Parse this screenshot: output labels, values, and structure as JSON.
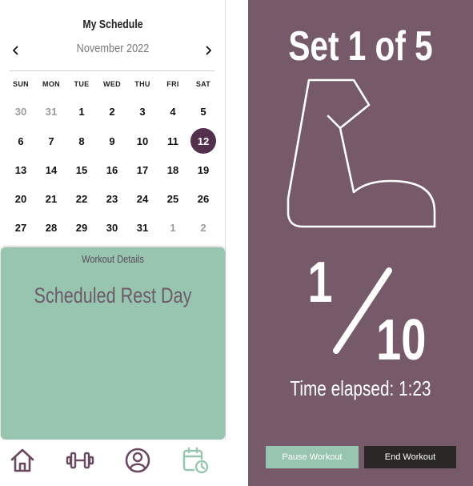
{
  "schedule": {
    "title": "My Schedule",
    "month": "November 2022",
    "weekdays": [
      "SUN",
      "MON",
      "TUE",
      "WED",
      "THU",
      "FRI",
      "SAT"
    ],
    "weeks": [
      [
        "30",
        "31",
        "1",
        "2",
        "3",
        "4",
        "5"
      ],
      [
        "6",
        "7",
        "8",
        "9",
        "10",
        "11",
        "12"
      ],
      [
        "13",
        "14",
        "15",
        "16",
        "17",
        "18",
        "19"
      ],
      [
        "20",
        "21",
        "22",
        "23",
        "24",
        "25",
        "26"
      ],
      [
        "27",
        "28",
        "29",
        "30",
        "31",
        "1",
        "2"
      ]
    ],
    "selected_day": "12"
  },
  "details": {
    "title": "Workout Details",
    "message": "Scheduled Rest Day"
  },
  "nav": {
    "items": [
      "home-icon",
      "dumbbell-icon",
      "profile-icon",
      "calendar-clock-icon"
    ],
    "active": "calendar-clock-icon"
  },
  "workout": {
    "set_label": "Set 1 of 5",
    "rep_current": "1",
    "rep_total": "10",
    "elapsed": "Time elapsed: 1:23",
    "pause_label": "Pause Workout",
    "end_label": "End Workout"
  },
  "colors": {
    "plum": "#54304f",
    "mauve": "#765a69",
    "mint": "#97c5b0",
    "dark": "#2a2826"
  }
}
